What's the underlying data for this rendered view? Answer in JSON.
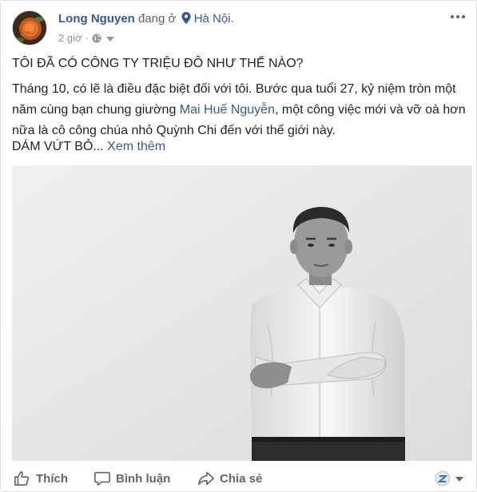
{
  "post": {
    "author": "Long Nguyen",
    "activity": "đang ở",
    "location": "Hà Nội.",
    "time": "2 giờ",
    "title": "TÔI ĐÃ CÓ CÔNG TY TRIỆU ĐÔ NHƯ THẾ NÀO?",
    "body_part1": "Tháng 10, có lẽ là điều đặc biệt đối với tôi. Bước qua tuổi 27, kỷ niệm tròn một năm cùng bạn chung giường ",
    "tagged_person": "Mai Huế Nguyễn",
    "body_part2": ", một công việc mới và vỡ oà hơn nữa là cô công chúa nhỏ Quỳnh Chi đến với thế giới này.",
    "tail_text": "DÁM VỨT BỎ...",
    "see_more": "Xem thêm"
  },
  "actions": {
    "like": "Thích",
    "comment": "Bình luận",
    "share": "Chia sẻ"
  },
  "icons": {
    "pin": "location-pin-icon",
    "globe": "globe-icon",
    "more": "more-options-icon",
    "like": "thumbs-up-icon",
    "comment": "speech-bubble-icon",
    "share": "share-arrow-icon"
  },
  "colors": {
    "link": "#365899",
    "text": "#1d2129",
    "meta": "#90949c",
    "action": "#606770"
  }
}
